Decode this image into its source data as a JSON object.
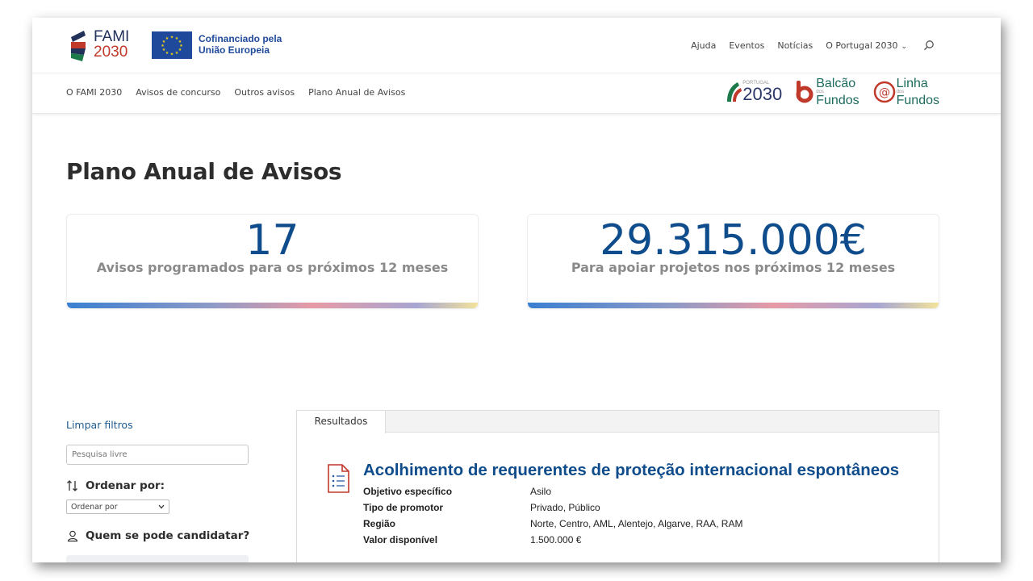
{
  "header": {
    "fami_line1": "FAMI",
    "fami_line2": "2030",
    "eu_line1": "Cofinanciado pela",
    "eu_line2": "União Europeia",
    "top_nav": {
      "ajuda": "Ajuda",
      "eventos": "Eventos",
      "noticias": "Notícias",
      "portugal": "O Portugal 2030"
    },
    "sub_nav": [
      "O FAMI 2030",
      "Avisos de concurso",
      "Outros avisos",
      "Plano Anual de Avisos"
    ],
    "brands": {
      "pt_small": "PORTUGAL",
      "pt_big": "2030",
      "balcao_line1": "Balcão",
      "balcao_small": "dos",
      "balcao_line2": "Fundos",
      "linha_line1": "Linha",
      "linha_small": "dos",
      "linha_line2": "Fundos"
    }
  },
  "page": {
    "title": "Plano Anual de Avisos"
  },
  "stats": [
    {
      "value": "17",
      "label": "Avisos programados para os próximos 12 meses"
    },
    {
      "value": "29.315.000€",
      "label": "Para apoiar projetos nos próximos 12 meses"
    }
  ],
  "filters": {
    "clear": "Limpar filtros",
    "search_placeholder": "Pesquisa livre",
    "order_heading": "Ordenar por:",
    "order_selected": "Ordenar por",
    "who_heading": "Quem se pode candidatar?"
  },
  "results": {
    "tab": "Resultados",
    "item": {
      "title": "Acolhimento de requerentes de proteção internacional espontâneos",
      "rows": [
        {
          "key": "Objetivo específico",
          "value": "Asilo"
        },
        {
          "key": "Tipo de promotor",
          "value": "Privado, Público"
        },
        {
          "key": "Região",
          "value": "Norte, Centro, AML, Alentejo, Algarve, RAA, RAM"
        },
        {
          "key": "Valor disponível",
          "value": "1.500.000 €"
        }
      ]
    }
  },
  "colors": {
    "primary_blue": "#0f4c8c",
    "link_blue": "#1f5a8e",
    "eu_blue": "#1f4a9c",
    "eu_star": "#f5d40c"
  }
}
